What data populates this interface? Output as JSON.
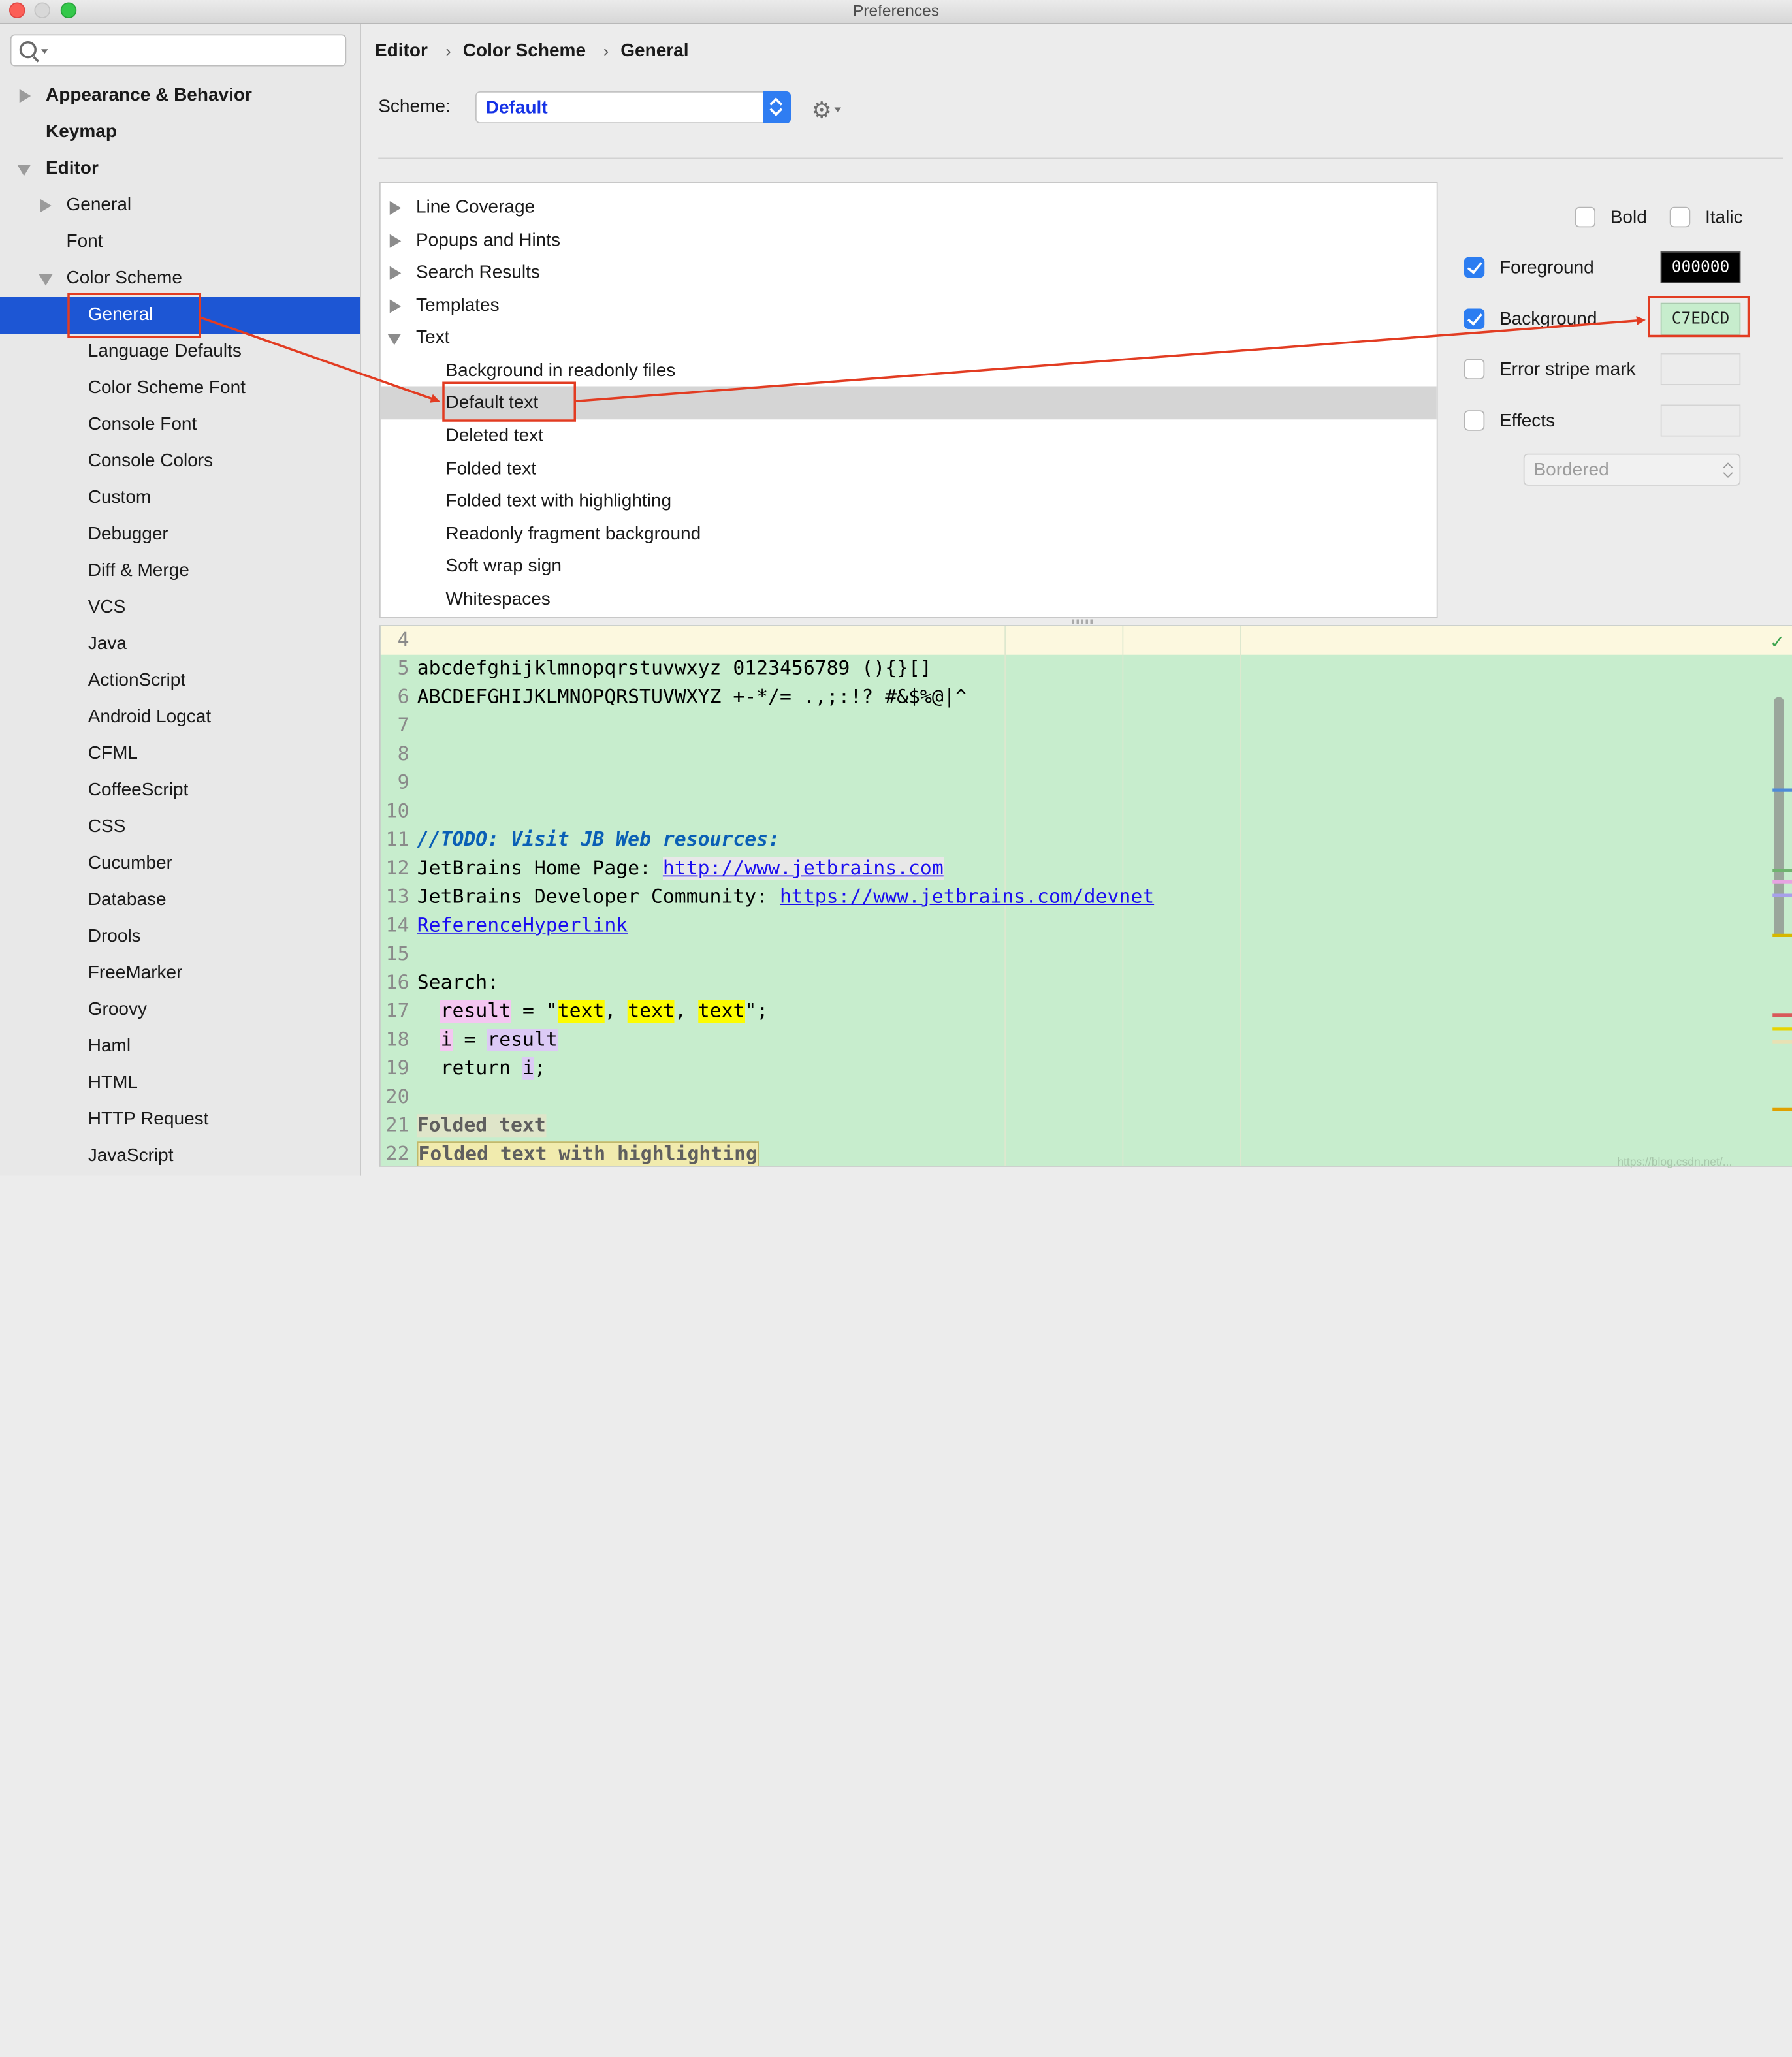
{
  "window": {
    "title": "Preferences"
  },
  "search": {
    "placeholder": ""
  },
  "sidebar": {
    "items": [
      {
        "label": "Appearance & Behavior"
      },
      {
        "label": "Keymap"
      },
      {
        "label": "Editor"
      },
      {
        "label": "General"
      },
      {
        "label": "Font"
      },
      {
        "label": "Color Scheme"
      },
      {
        "label": "General"
      },
      {
        "label": "Language Defaults"
      },
      {
        "label": "Color Scheme Font"
      },
      {
        "label": "Console Font"
      },
      {
        "label": "Console Colors"
      },
      {
        "label": "Custom"
      },
      {
        "label": "Debugger"
      },
      {
        "label": "Diff & Merge"
      },
      {
        "label": "VCS"
      },
      {
        "label": "Java"
      },
      {
        "label": "ActionScript"
      },
      {
        "label": "Android Logcat"
      },
      {
        "label": "CFML"
      },
      {
        "label": "CoffeeScript"
      },
      {
        "label": "CSS"
      },
      {
        "label": "Cucumber"
      },
      {
        "label": "Database"
      },
      {
        "label": "Drools"
      },
      {
        "label": "FreeMarker"
      },
      {
        "label": "Groovy"
      },
      {
        "label": "Haml"
      },
      {
        "label": "HTML"
      },
      {
        "label": "HTTP Request"
      },
      {
        "label": "JavaScript"
      }
    ]
  },
  "breadcrumb": {
    "items": [
      "Editor",
      "Color Scheme",
      "General"
    ],
    "separator": "›"
  },
  "scheme": {
    "label": "Scheme:",
    "value": "Default"
  },
  "tree": {
    "items": [
      {
        "label": "Line Coverage"
      },
      {
        "label": "Popups and Hints"
      },
      {
        "label": "Search Results"
      },
      {
        "label": "Templates"
      },
      {
        "label": "Text"
      },
      {
        "label": "Background in readonly files"
      },
      {
        "label": "Default text"
      },
      {
        "label": "Deleted text"
      },
      {
        "label": "Folded text"
      },
      {
        "label": "Folded text with highlighting"
      },
      {
        "label": "Readonly fragment background"
      },
      {
        "label": "Soft wrap sign"
      },
      {
        "label": "Whitespaces"
      }
    ]
  },
  "attributes": {
    "bold": {
      "label": "Bold",
      "checked": false
    },
    "italic": {
      "label": "Italic",
      "checked": false
    },
    "foreground": {
      "label": "Foreground",
      "checked": true,
      "value": "000000",
      "color": "#000000"
    },
    "background": {
      "label": "Background",
      "checked": true,
      "value": "C7EDCD",
      "color": "#c7edcd"
    },
    "error_stripe": {
      "label": "Error stripe mark",
      "checked": false
    },
    "effects": {
      "label": "Effects",
      "checked": false,
      "type": "Bordered"
    }
  },
  "preview": {
    "lines": [
      {
        "n": "4"
      },
      {
        "n": "5",
        "text": "abcdefghijklmnopqrstuvwxyz 0123456789 (){}[]"
      },
      {
        "n": "6",
        "text": "ABCDEFGHIJKLMNOPQRSTUVWXYZ +-*/= .,;:!? #&$%@|^"
      },
      {
        "n": "7"
      },
      {
        "n": "8"
      },
      {
        "n": "9"
      },
      {
        "n": "10"
      },
      {
        "n": "11",
        "todo": "//TODO: Visit JB Web resources:"
      },
      {
        "n": "12",
        "text": "JetBrains Home Page: ",
        "link": "http://www.jetbrains.com"
      },
      {
        "n": "13",
        "text": "JetBrains Developer Community: ",
        "link": "https://www.jetbrains.com/devnet"
      },
      {
        "n": "14",
        "link": "ReferenceHyperlink"
      },
      {
        "n": "15"
      },
      {
        "n": "16",
        "text": "Search:"
      },
      {
        "n": "17",
        "t1": "result",
        "t2": " = \"",
        "t3": "text",
        "t4": ", ",
        "t5": "text",
        "t6": ", ",
        "t7": "text",
        "t8": "\";"
      },
      {
        "n": "18",
        "t1": "i",
        "t2": " = ",
        "t3": "result"
      },
      {
        "n": "19",
        "t1": "return ",
        "t2": "i",
        "t3": ";"
      },
      {
        "n": "20"
      },
      {
        "n": "21",
        "fold": "Folded text"
      },
      {
        "n": "22",
        "foldh": "Folded text with highlighting"
      }
    ]
  },
  "watermark": "https://blog.csdn.net/...",
  "colors": {
    "selection": "#1d56d4",
    "annotation": "#e23c22",
    "preview_bg": "#c7edcd"
  }
}
